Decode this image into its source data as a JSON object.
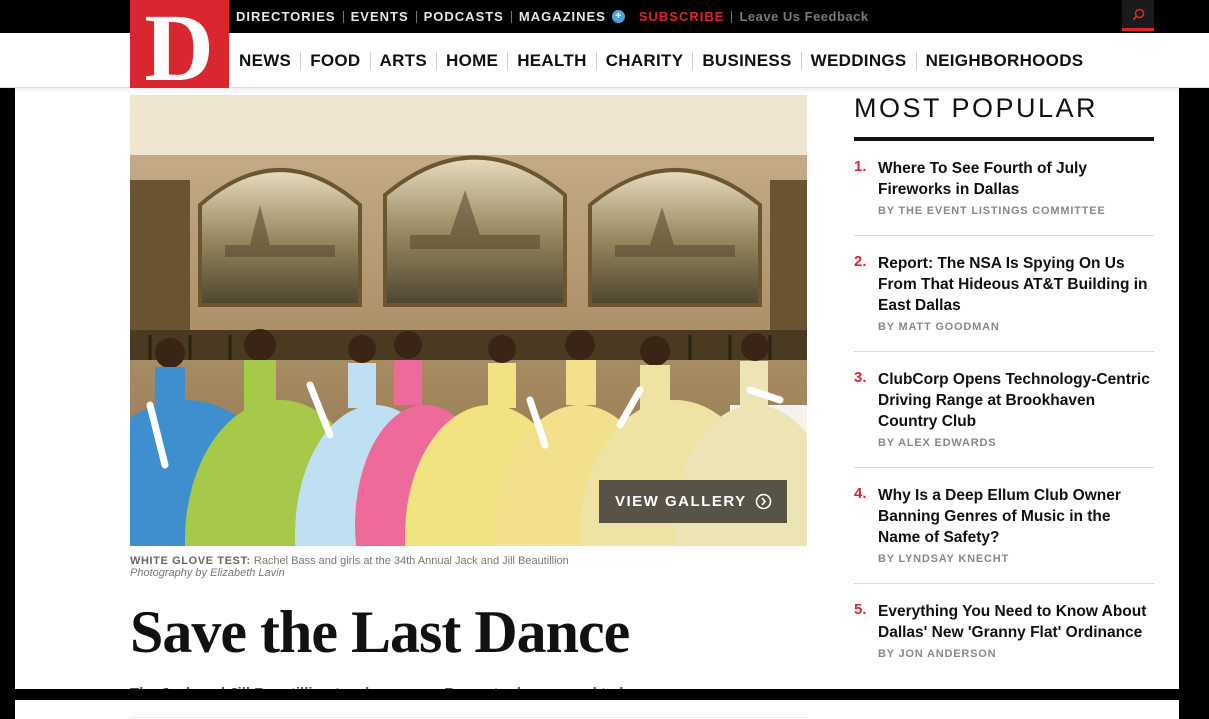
{
  "top_nav": {
    "items": [
      {
        "label": "DIRECTORIES"
      },
      {
        "label": "EVENTS"
      },
      {
        "label": "PODCASTS"
      },
      {
        "label": "MAGAZINES"
      }
    ],
    "magazines_badge": "+",
    "subscribe": "SUBSCRIBE",
    "feedback": "Leave Us Feedback"
  },
  "logo": {
    "letter": "D"
  },
  "main_nav": {
    "items": [
      {
        "label": "NEWS"
      },
      {
        "label": "FOOD"
      },
      {
        "label": "ARTS"
      },
      {
        "label": "HOME"
      },
      {
        "label": "HEALTH"
      },
      {
        "label": "CHARITY"
      },
      {
        "label": "BUSINESS"
      },
      {
        "label": "WEDDINGS"
      },
      {
        "label": "NEIGHBORHOODS"
      }
    ]
  },
  "article": {
    "gallery_button": "VIEW GALLERY",
    "caption_title": "WHITE GLOVE TEST:",
    "caption_text": "Rachel Bass and girls at the 34th Annual Jack and Jill Beautillion",
    "photo_credit": "Photography by Elizabeth Lavin",
    "headline": "Save the Last Dance",
    "dek": "The Jack and Jill Beautillion teaches young Beaux to dance—and to be men."
  },
  "most_popular": {
    "title": "MOST POPULAR",
    "items": [
      {
        "num": "1.",
        "title": "Where To See Fourth of July Fireworks in Dallas",
        "byline": "BY THE EVENT LISTINGS COMMITTEE"
      },
      {
        "num": "2.",
        "title": "Report: The NSA Is Spying On Us From That Hideous AT&T Building in East Dallas",
        "byline": "BY MATT GOODMAN"
      },
      {
        "num": "3.",
        "title": "ClubCorp Opens Technology-Centric Driving Range at Brookhaven Country Club",
        "byline": "BY ALEX EDWARDS"
      },
      {
        "num": "4.",
        "title": "Why Is a Deep Ellum Club Owner Banning Genres of Music in the Name of Safety?",
        "byline": "BY LYNDSAY KNECHT"
      },
      {
        "num": "5.",
        "title": "Everything You Need to Know About Dallas' New 'Granny Flat' Ordinance",
        "byline": "BY JON ANDERSON"
      }
    ]
  },
  "colors": {
    "brand_red": "#d9262f",
    "accent_blue": "#4aa3df"
  }
}
